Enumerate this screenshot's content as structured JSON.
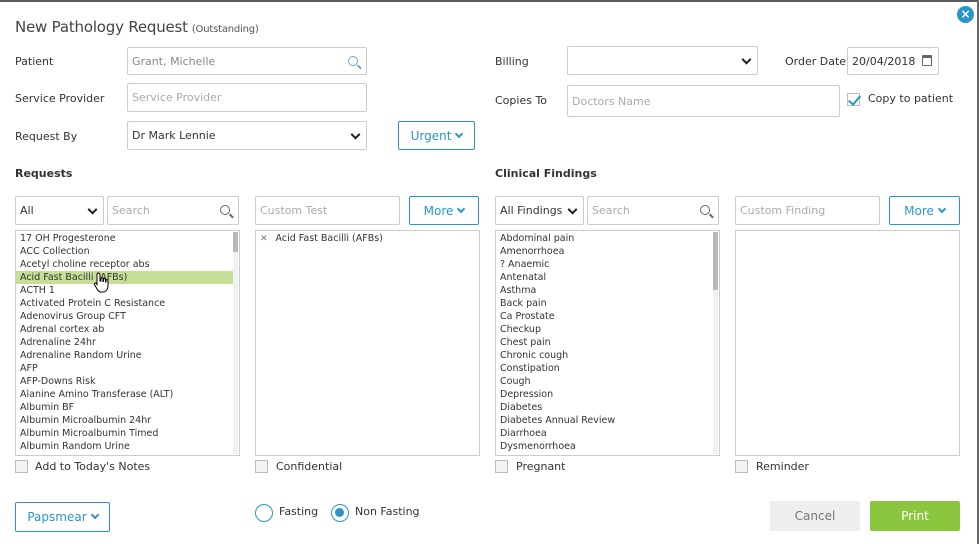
{
  "dialog": {
    "title": "New Pathology Request",
    "status": "(Outstanding)",
    "close_label": "×"
  },
  "patient": {
    "label": "Patient",
    "value": "Grant, Michelle"
  },
  "service_provider": {
    "label": "Service Provider",
    "placeholder": "Service Provider"
  },
  "request_by": {
    "label": "Request By",
    "value": "Dr Mark Lennie"
  },
  "urgent_button": "Urgent",
  "billing": {
    "label": "Billing",
    "value": ""
  },
  "order_date": {
    "label": "Order Date",
    "value": "20/04/2018"
  },
  "copies_to": {
    "label": "Copies To",
    "placeholder": "Doctors Name"
  },
  "copy_to_patient": {
    "label": "Copy to patient",
    "checked": true
  },
  "requests": {
    "title": "Requests",
    "filter_value": "All",
    "search_placeholder": "Search",
    "custom_placeholder": "Custom Test",
    "more_label": "More",
    "items": [
      "17 OH Progesterone",
      "ACC Collection",
      "Acetyl choline receptor abs",
      "Acid Fast Bacilli (AFBs)",
      "ACTH 1",
      "Activated Protein C Resistance",
      "Adenovirus Group CFT",
      "Adrenal cortex ab",
      "Adrenaline 24hr",
      "Adrenaline Random Urine",
      "AFP",
      "AFP-Downs Risk",
      "Alanine Amino Transferase (ALT)",
      "Albumin BF",
      "Albumin Microalbumin 24hr",
      "Albumin Microalbumin Timed",
      "Albumin Random Urine"
    ],
    "selected_index": 3,
    "selected_items": [
      "Acid Fast Bacilli (AFBs)"
    ],
    "add_notes_label": "Add to Today's Notes",
    "confidential_label": "Confidential"
  },
  "clinical": {
    "title": "Clinical Findings",
    "filter_value": "All Findings",
    "search_placeholder": "Search",
    "custom_placeholder": "Custom Finding",
    "more_label": "More",
    "items": [
      "Abdominal pain",
      "Amenorrhoea",
      "? Anaemic",
      "Antenatal",
      "Asthma",
      "Back pain",
      "Ca Prostate",
      "Checkup",
      "Chest pain",
      "Chronic cough",
      "Constipation",
      "Cough",
      "Depression",
      "Diabetes",
      "Diabetes Annual Review",
      "Diarrhoea",
      "Dysmenorrhoea"
    ],
    "selected_items": [],
    "pregnant_label": "Pregnant",
    "reminder_label": "Reminder"
  },
  "papsmear_button": "Papsmear",
  "fasting": {
    "fasting_label": "Fasting",
    "non_fasting_label": "Non Fasting",
    "selected": "Non Fasting"
  },
  "cancel_button": "Cancel",
  "print_button": "Print",
  "colors": {
    "accent": "#2b95c9",
    "print_green": "#8cc63f",
    "selected_row": "#c5df97"
  }
}
